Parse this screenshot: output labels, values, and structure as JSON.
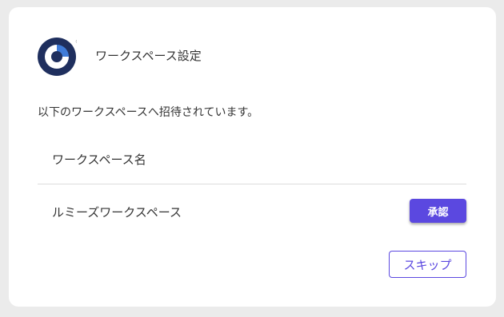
{
  "header": {
    "title": "ワークスペース設定",
    "logo_icon": "brand-logo-icon",
    "logo_mark": "®"
  },
  "invite": {
    "message": "以下のワークスペースへ招待されています。"
  },
  "workspace_list": {
    "column_header": "ワークスペース名",
    "rows": [
      {
        "name": "ルミーズワークスペース",
        "action_label": "承認"
      }
    ]
  },
  "actions": {
    "skip_label": "スキップ"
  },
  "colors": {
    "accent": "#5b48e0",
    "page_background": "#ebebeb",
    "card_background": "#ffffff",
    "logo_dark": "#1f2f5e",
    "logo_blue": "#3f7bd8"
  }
}
